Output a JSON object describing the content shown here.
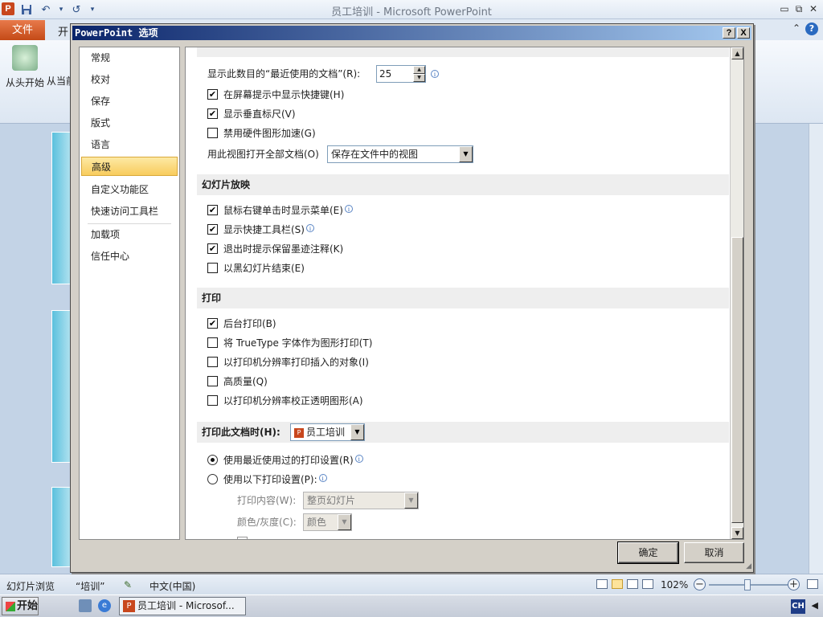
{
  "powerpoint": {
    "window_title": "员工培训 - Microsoft PowerPoint",
    "app_icon": "P",
    "file_tab": "文件",
    "tab_partial": "开",
    "ribbon": {
      "from_start": "从头开始",
      "from_current": "从当前"
    },
    "help_glyph": "?",
    "collapse_glyph": "⌃",
    "minimize_glyph": "▭",
    "restore_glyph": "⧉",
    "close_glyph": "✕",
    "qat": {
      "undo_glyph": "↶",
      "redo_glyph": "↺",
      "more_glyph": "▾"
    },
    "status": {
      "view_mode": "幻灯片浏览",
      "theme": "“培训”",
      "language": "中文(中国)",
      "zoom": "102%",
      "zoom_minus": "−",
      "zoom_plus": "+"
    }
  },
  "taskbar": {
    "start": "开始",
    "task": "员工培训 - Microsof...",
    "ime": "CH",
    "arrow": "◀"
  },
  "dialog": {
    "title": "PowerPoint 选项",
    "help_btn": "?",
    "close_btn": "X",
    "nav": [
      "常规",
      "校对",
      "保存",
      "版式",
      "语言",
      "高级",
      "自定义功能区",
      "快速访问工具栏",
      "加载项",
      "信任中心"
    ],
    "nav_active_index": 5,
    "display": {
      "recent_docs_label": "显示此数目的“最近使用的文档”(R):",
      "recent_docs_value": "25",
      "show_shortcut_keys": {
        "label": "在屏幕提示中显示快捷键(H)",
        "checked": true
      },
      "show_vertical_ruler": {
        "label": "显示垂直标尺(V)",
        "checked": true
      },
      "disable_hw_accel": {
        "label": "禁用硬件图形加速(G)",
        "checked": false
      },
      "open_view_label": "用此视图打开全部文档(O)",
      "open_view_value": "保存在文件中的视图"
    },
    "slideshow": {
      "header": "幻灯片放映",
      "items": [
        {
          "label": "鼠标右键单击时显示菜单(E)",
          "checked": true,
          "info": true
        },
        {
          "label": "显示快捷工具栏(S)",
          "checked": true,
          "info": true
        },
        {
          "label": "退出时提示保留墨迹注释(K)",
          "checked": true,
          "info": false
        },
        {
          "label": "以黑幻灯片结束(E)",
          "checked": false,
          "info": false
        }
      ]
    },
    "print": {
      "header": "打印",
      "items": [
        {
          "label": "后台打印(B)",
          "checked": true
        },
        {
          "label": "将 TrueType 字体作为图形打印(T)",
          "checked": false
        },
        {
          "label": "以打印机分辨率打印插入的对象(I)",
          "checked": false
        },
        {
          "label": "高质量(Q)",
          "checked": false
        },
        {
          "label": "以打印机分辨率校正透明图形(A)",
          "checked": false
        }
      ]
    },
    "print_doc": {
      "header": "打印此文档时(H):",
      "doc_value": "员工培训",
      "use_recent": "使用最近使用过的打印设置(R)",
      "use_following": "使用以下打印设置(P):",
      "selected": "use_recent",
      "content_label": "打印内容(W):",
      "content_value": "整页幻灯片",
      "color_label": "颜色/灰度(C):",
      "color_value": "颜色"
    },
    "ok": "确定",
    "cancel": "取消",
    "info_glyph": "i",
    "check_glyph": "✔",
    "arrow_glyph": "▼",
    "scroll_up_glyph": "▲",
    "scroll_down_glyph": "▼"
  }
}
